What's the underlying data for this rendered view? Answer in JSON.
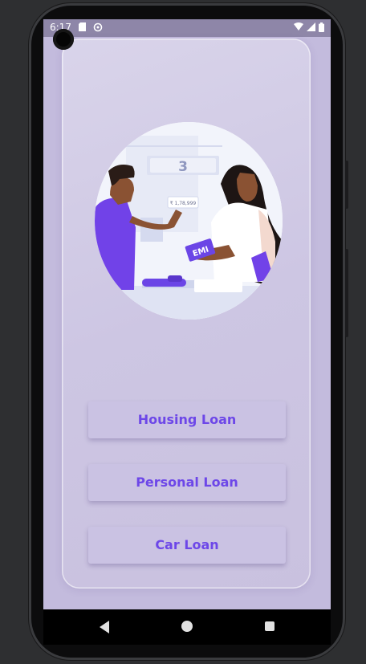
{
  "status_bar": {
    "time": "6:17",
    "icons": [
      "sd-card-icon",
      "sync-icon",
      "wifi-icon",
      "signal-icon",
      "battery-icon"
    ]
  },
  "illustration": {
    "counter_number": "3",
    "price_tag": "₹ 1,78,999",
    "card_label": "EMI"
  },
  "buttons": {
    "housing": "Housing Loan",
    "personal": "Personal Loan",
    "car": "Car Loan"
  },
  "colors": {
    "accent": "#6d47e8",
    "button_bg": "#cac2e3",
    "screen_bg": "#c3bbdd",
    "card_bg": "#d5cfe7"
  },
  "navigation": [
    "back",
    "home",
    "recents"
  ]
}
